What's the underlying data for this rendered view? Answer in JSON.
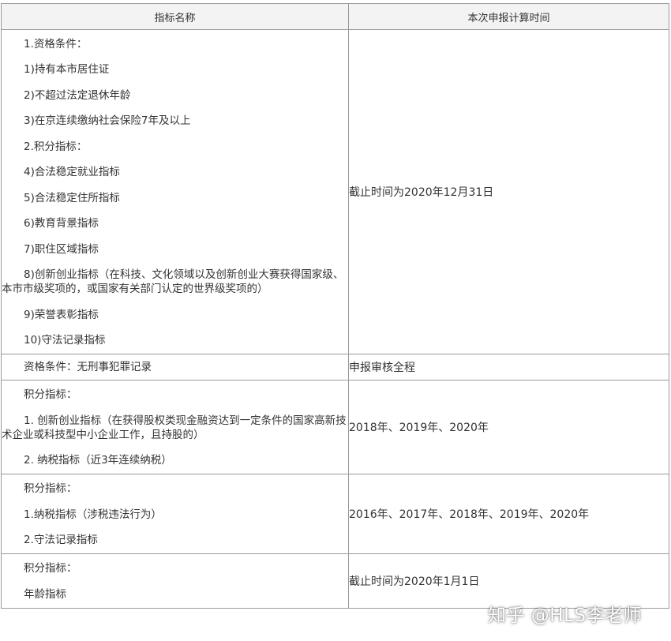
{
  "table": {
    "headers": [
      "指标名称",
      "本次申报计算时间"
    ],
    "row1": {
      "items": [
        "1.资格条件：",
        "1)持有本市居住证",
        "2)不超过法定退休年龄",
        "3)在京连续缴纳社会保险7年及以上",
        "2.积分指标：",
        "4)合法稳定就业指标",
        "5)合法稳定住所指标",
        "6)教育背景指标",
        "7)职住区域指标",
        "8)创新创业指标（在科技、文化领域以及创新创业大赛获得国家级、本市市级奖项的，或国家有关部门认定的世界级奖项的）",
        "9)荣誉表彰指标",
        "10)守法记录指标"
      ],
      "time": "截止时间为2020年12月31日"
    },
    "row2": {
      "name": "资格条件：无刑事犯罪记录",
      "time": "申报审核全程"
    },
    "row3": {
      "items": [
        "积分指标：",
        "1. 创新创业指标（在获得股权类现金融资达到一定条件的国家高新技术企业或科技型中小企业工作，且持股的）",
        "2. 纳税指标（近3年连续纳税）"
      ],
      "time": "2018年、2019年、2020年"
    },
    "row4": {
      "items": [
        "积分指标：",
        "1.纳税指标（涉税违法行为）",
        "2.守法记录指标"
      ],
      "time": "2016年、2017年、2018年、2019年、2020年"
    },
    "row5": {
      "items": [
        "积分指标：",
        "年龄指标"
      ],
      "time": "截止时间为2020年1月1日"
    }
  },
  "watermark": "知乎 @HLS李老师"
}
